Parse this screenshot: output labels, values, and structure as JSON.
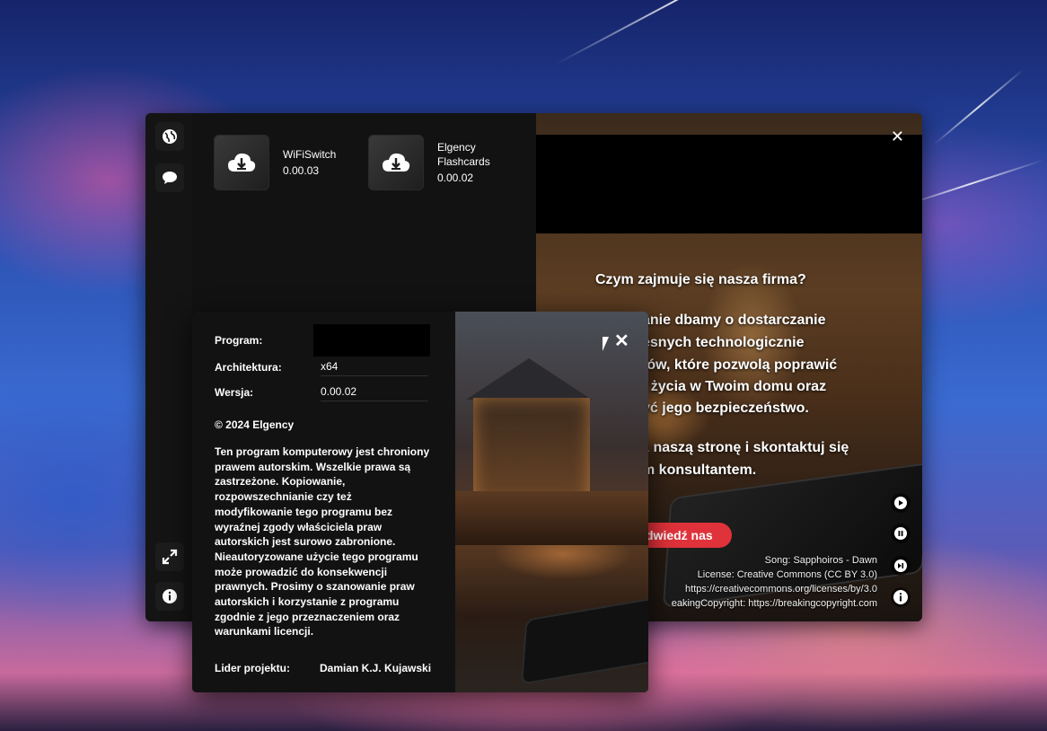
{
  "sidebar": {
    "top_icons": [
      "globe-icon",
      "chat-icon"
    ],
    "bottom_icons": [
      "expand-icon",
      "info-icon"
    ]
  },
  "apps": [
    {
      "name": "WiFiSwitch",
      "version": "0.00.03",
      "icon": "download-cloud-icon"
    },
    {
      "name_line1": "Elgency",
      "name_line2": "Flashcards",
      "version": "0.00.02",
      "icon": "download-cloud-icon"
    }
  ],
  "news": {
    "heading": "Czym zajmuje się nasza firma?",
    "body_lines": [
      "anie dbamy o dostarczanie",
      "esnych technologicznie",
      "tów, które pozwolą poprawić",
      "t życia w Twoim domu oraz",
      "yć jego bezpieczeństwo."
    ],
    "contact_lines": [
      "ź naszą stronę i skontaktuj się",
      "m konsultantem."
    ],
    "visit_label": "dwiedź nas",
    "credits": [
      "Song: Sapphoiros - Dawn",
      "License: Creative Commons (CC BY 3.0)",
      "https://creativecommons.org/licenses/by/3.0",
      "eakingCopyright: https://breakingcopyright.com"
    ]
  },
  "about": {
    "program_label": "Program:",
    "program_value": "",
    "arch_label": "Architektura:",
    "arch_value": "x64",
    "version_label": "Wersja:",
    "version_value": "0.00.02",
    "copyright": "© 2024 Elgency",
    "legal_text": "Ten program komputerowy jest chroniony prawem autorskim. Wszelkie prawa są zastrzeżone. Kopiowanie, rozpowszechnianie czy też modyfikowanie tego programu bez wyraźnej zgody właściciela praw autorskich jest surowo zabronione. Nieautoryzowane użycie tego programu może prowadzić do konsekwencji prawnych. Prosimy o szanowanie praw autorskich i korzystanie z programu zgodnie z jego przeznaczeniem oraz warunkami licencji.",
    "leader_label": "Lider projektu:",
    "leader_value": "Damian K.J. Kujawski"
  }
}
